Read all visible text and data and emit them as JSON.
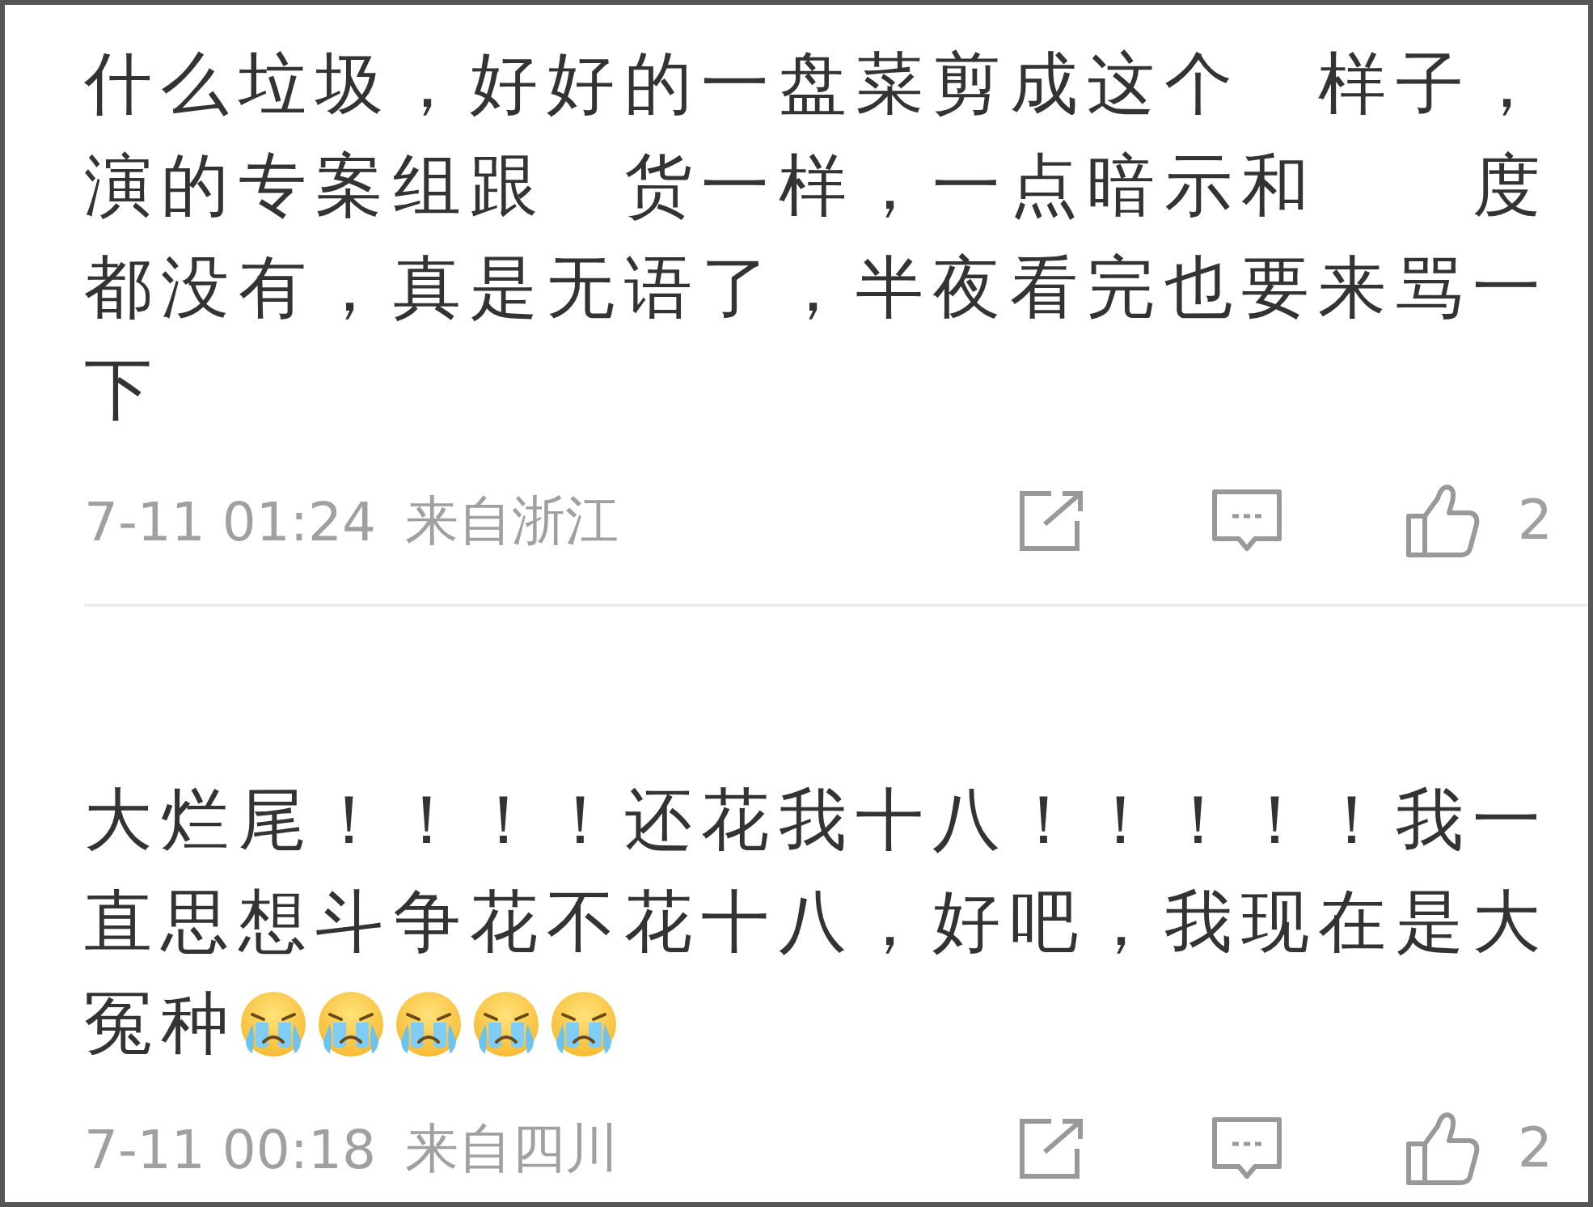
{
  "comments": [
    {
      "lines": [
        "什么垃圾，好好的一盘菜剪成这个　样子，",
        "演的专案组跟　货一样，一点暗示和　　度",
        "都没有，真是无语了，半夜看完也要来骂一",
        "下"
      ],
      "time": "7-11 01:24",
      "location": "来自浙江",
      "likes": "2"
    },
    {
      "lines": [
        "大烂尾！！！！还花我十八！！！！！我一",
        "直思想斗争花不花十八，好吧，我现在是大",
        "冤种"
      ],
      "emojis": [
        {
          "kind": "crying"
        },
        {
          "kind": "crying"
        },
        {
          "kind": "crying"
        },
        {
          "kind": "crying"
        },
        {
          "kind": "crying"
        }
      ],
      "time": "7-11 00:18",
      "location": "来自四川",
      "likes": "2"
    }
  ]
}
